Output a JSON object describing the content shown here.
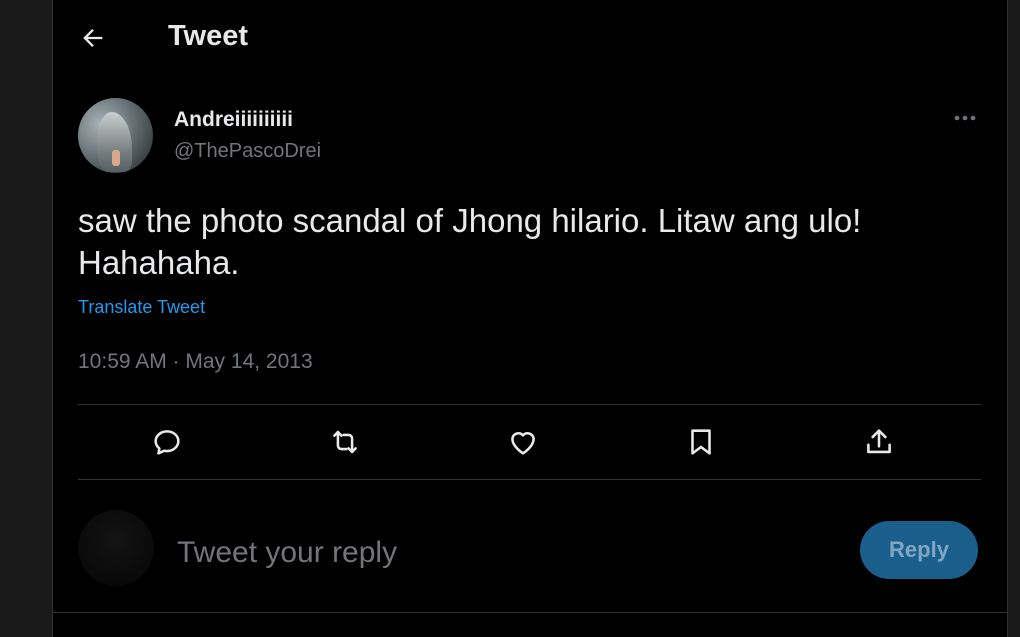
{
  "header": {
    "title": "Tweet",
    "back_icon": "arrow-left-icon"
  },
  "tweet": {
    "author_name": "Andreiiiiiiiiii",
    "author_handle": "@ThePascoDrei",
    "text": "saw the photo scandal of Jhong hilario. Litaw ang ulo! Hahahaha.",
    "translate_label": "Translate Tweet",
    "timestamp": "10:59 AM · May 14, 2013",
    "more_icon": "ellipsis-icon"
  },
  "actions": [
    {
      "name": "reply-icon"
    },
    {
      "name": "retweet-icon"
    },
    {
      "name": "like-icon"
    },
    {
      "name": "bookmark-icon"
    },
    {
      "name": "share-icon"
    }
  ],
  "reply_box": {
    "placeholder": "Tweet your reply",
    "button_label": "Reply"
  },
  "colors": {
    "background": "#000000",
    "text": "#e7e9ea",
    "secondary": "#71767b",
    "link": "#1d9bf0",
    "reply_button": "#1a5f8c"
  }
}
